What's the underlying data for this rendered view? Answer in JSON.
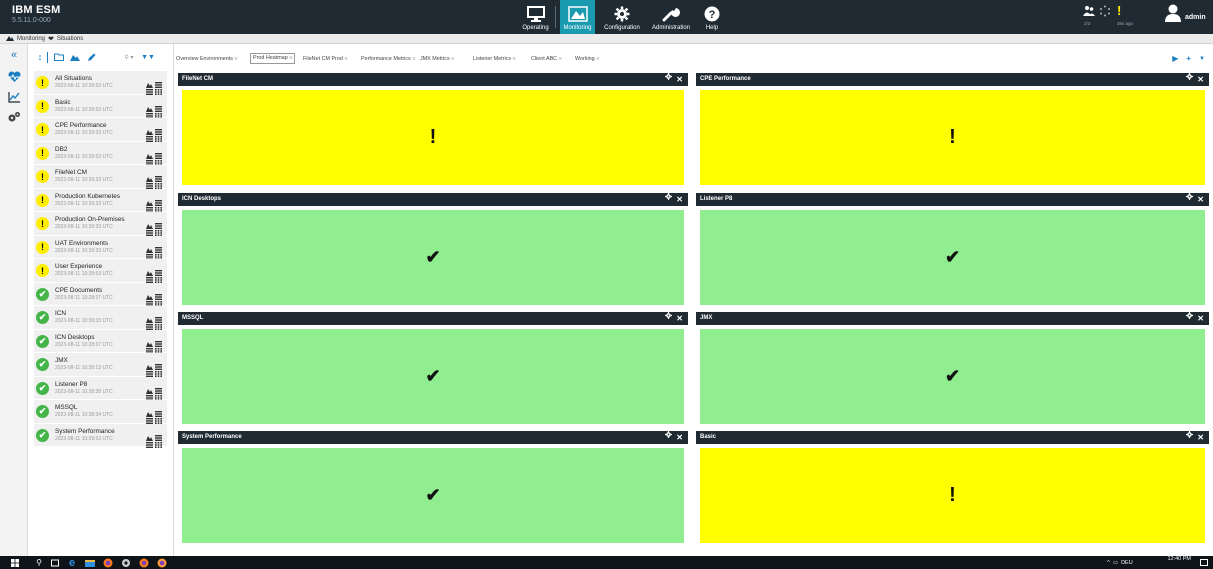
{
  "app": {
    "name": "IBM ESM",
    "version": "5.5.11.0-000"
  },
  "nav": [
    {
      "label": "Operating",
      "icon": "monitor-icon"
    },
    {
      "label": "Monitoring",
      "icon": "chart-icon"
    },
    {
      "label": "Configuration",
      "icon": "gear-icon"
    },
    {
      "label": "Administration",
      "icon": "wrench-icon"
    },
    {
      "label": "Help",
      "icon": "help-icon"
    }
  ],
  "status": {
    "count": "2/3",
    "ago": "35s ago"
  },
  "user": {
    "name": "admin"
  },
  "breadcrumb": {
    "section": "Monitoring",
    "page": "Situations"
  },
  "situations": [
    {
      "name": "All Situations",
      "time": "2023-08-11 10:39:53 UTC",
      "status": "warning"
    },
    {
      "name": "Basic",
      "time": "2023-08-11 10:39:53 UTC",
      "status": "warning"
    },
    {
      "name": "CPE Performance",
      "time": "2023-08-11 10:39:33 UTC",
      "status": "warning"
    },
    {
      "name": "DB2",
      "time": "2023-08-11 10:39:53 UTC",
      "status": "warning"
    },
    {
      "name": "FileNet CM",
      "time": "2023-08-11 10:39:33 UTC",
      "status": "warning"
    },
    {
      "name": "Production Kubernetes",
      "time": "2023-08-11 10:39:33 UTC",
      "status": "warning"
    },
    {
      "name": "Production On-Premises",
      "time": "2023-08-11 10:39:33 UTC",
      "status": "warning"
    },
    {
      "name": "UAT Environments",
      "time": "2023-08-11 10:39:33 UTC",
      "status": "warning"
    },
    {
      "name": "User Experience",
      "time": "2023-08-11 10:39:53 UTC",
      "status": "warning"
    },
    {
      "name": "CPE Documents",
      "time": "2023-08-11 10:28:37 UTC",
      "status": "ok"
    },
    {
      "name": "ICN",
      "time": "2023-08-11 10:39:33 UTC",
      "status": "ok"
    },
    {
      "name": "ICN Desktops",
      "time": "2023-08-11 10:28:37 UTC",
      "status": "ok"
    },
    {
      "name": "JMX",
      "time": "2023-08-11 10:39:13 UTC",
      "status": "ok"
    },
    {
      "name": "Listener P8",
      "time": "2023-08-11 10:28:38 UTC",
      "status": "ok"
    },
    {
      "name": "MSSQL",
      "time": "2023-08-11 10:38:34 UTC",
      "status": "ok"
    },
    {
      "name": "System Performance",
      "time": "2023-08-11 10:39:53 UTC",
      "status": "ok"
    }
  ],
  "tabs": [
    "Overview Environments",
    "Prod Heatmap",
    "FileNet CM Prod",
    "Performance Metrics",
    "JMX Metrics",
    "Listener Metrics",
    "Client ABC",
    "Working"
  ],
  "active_tab": "Prod Heatmap",
  "tiles": [
    {
      "title": "FileNet CM",
      "status": "warning",
      "mark": "!"
    },
    {
      "title": "CPE Performance",
      "status": "warning",
      "mark": "!"
    },
    {
      "title": "ICN Desktops",
      "status": "ok",
      "mark": "✔"
    },
    {
      "title": "Listener P8",
      "status": "ok",
      "mark": "✔"
    },
    {
      "title": "MSSQL",
      "status": "ok",
      "mark": "✔"
    },
    {
      "title": "JMX",
      "status": "ok",
      "mark": "✔"
    },
    {
      "title": "System Performance",
      "status": "ok",
      "mark": "✔"
    },
    {
      "title": "Basic",
      "status": "warning",
      "mark": "!"
    }
  ],
  "colors": {
    "header": "#1f2a33",
    "accent": "#1b9bb0",
    "warning": "#ffff00",
    "ok": "#90ee90",
    "ok_icon": "#45b54a"
  },
  "taskbar": {
    "language": "DEU",
    "time": "12:40 PM"
  }
}
